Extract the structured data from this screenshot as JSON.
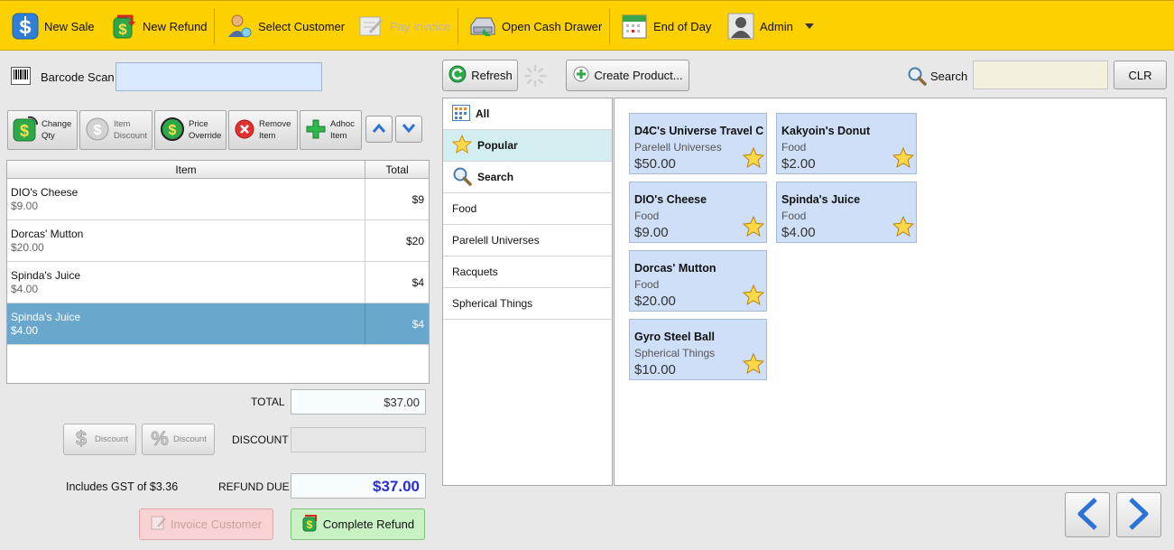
{
  "toolbar": {
    "new_sale": "New Sale",
    "new_refund": "New Refund",
    "select_customer": "Select Customer",
    "pay_invoice": "Pay Invoice",
    "open_cash_drawer": "Open Cash Drawer",
    "end_of_day": "End of Day",
    "admin": "Admin"
  },
  "barcode": {
    "label": "Barcode Scan",
    "value": ""
  },
  "item_buttons": {
    "change_qty": [
      "Change",
      "Qty"
    ],
    "item_discount": [
      "Item",
      "Discount"
    ],
    "price_override": [
      "Price",
      "Override"
    ],
    "remove_item": [
      "Remove",
      "Item"
    ],
    "adhoc_item": [
      "Adhoc",
      "Item"
    ]
  },
  "cart": {
    "columns": [
      "Item",
      "Total"
    ],
    "rows": [
      {
        "name": "DIO's Cheese",
        "price": "$9.00",
        "total": "$9"
      },
      {
        "name": "Dorcas' Mutton",
        "price": "$20.00",
        "total": "$20"
      },
      {
        "name": "Spinda's Juice",
        "price": "$4.00",
        "total": "$4"
      },
      {
        "name": "Spinda's Juice",
        "price": "$4.00",
        "total": "$4"
      }
    ]
  },
  "totals": {
    "total_label": "TOTAL",
    "total_value": "$37.00",
    "discount_label": "DISCOUNT",
    "discount_value": "",
    "discount_btn_amount": "Discount",
    "discount_btn_percent": "Discount",
    "gst": "Includes GST of $3.36",
    "refund_label": "REFUND DUE",
    "refund_value": "$37.00"
  },
  "actions": {
    "invoice_customer": "Invoice Customer",
    "complete_refund": "Complete Refund"
  },
  "product_bar": {
    "refresh": "Refresh",
    "create_product": "Create Product...",
    "search_label": "Search",
    "search_value": "",
    "clr": "CLR"
  },
  "categories": [
    "All",
    "Popular",
    "Search",
    "Food",
    "Parelell Universes",
    "Racquets",
    "Spherical Things"
  ],
  "products": [
    {
      "name": "D4C's Universe Travel C",
      "category": "Parelell Universes",
      "price": "$50.00"
    },
    {
      "name": "Kakyoin's Donut",
      "category": "Food",
      "price": "$2.00"
    },
    {
      "name": "DIO's Cheese",
      "category": "Food",
      "price": "$9.00"
    },
    {
      "name": "Spinda's Juice",
      "category": "Food",
      "price": "$4.00"
    },
    {
      "name": "Dorcas' Mutton",
      "category": "Food",
      "price": "$20.00"
    },
    {
      "name": "Gyro Steel Ball",
      "category": "Spherical Things",
      "price": "$10.00"
    }
  ],
  "colors": {
    "toolbar": "#fdd000",
    "selected_row": "#6aa7cc",
    "tile": "#cfdff8",
    "refund_value": "#2b2bd6",
    "complete_refund_btn": "#c8f2c4",
    "invoice_btn": "#f9d3d3"
  }
}
